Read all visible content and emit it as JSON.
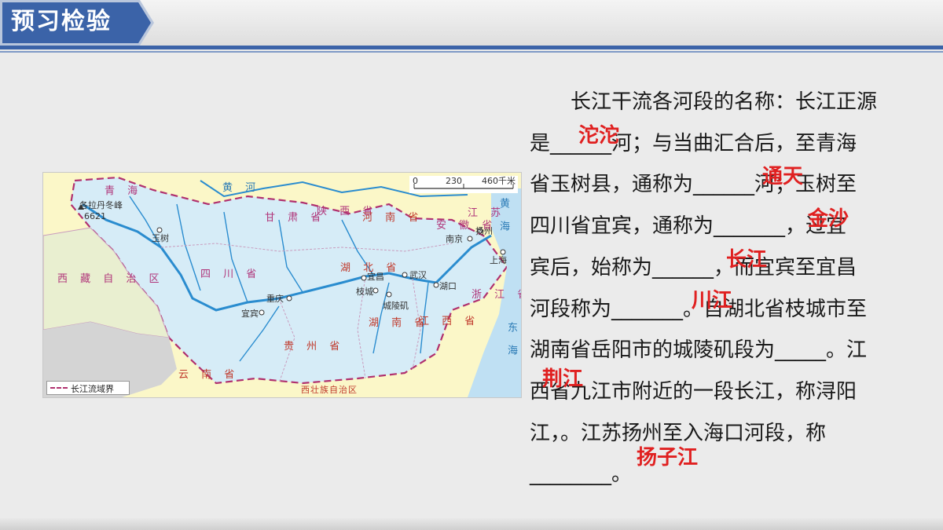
{
  "header": {
    "title": "预习检验"
  },
  "map": {
    "scale_labels": [
      "0",
      "230",
      "460千米"
    ],
    "legend_label": "长江流域界",
    "places": {
      "geladandong": "各拉丹冬峰",
      "geladandong_alt": "6621",
      "yushu": "玉树",
      "chongqing": "重庆",
      "yibin": "宜宾",
      "yichang": "宜昌",
      "zhicheng": "枝城",
      "chenglingji": "城陵矶",
      "wuhan": "武汉",
      "hukou": "湖口",
      "nanjing": "南京",
      "yangzhou": "扬州",
      "shanghai": "上海"
    },
    "regions": {
      "tibet": "西 藏 自 治 区",
      "qinghai": "青 海",
      "gansu": "甘 肃 省",
      "shaanxi": "陕 西 省",
      "sichuan": "四 川 省",
      "henan": "河 南 省",
      "hubei": "湖 北 省",
      "hunan": "湖 南 省",
      "jiangxi": "江 西 省",
      "anhui": "安 徽 省",
      "jiangsu": "江 苏",
      "zhejiang": "浙 江 省",
      "guizhou": "贵 州 省",
      "yunnan": "云 南 省",
      "guangxi": "西壮族自治区",
      "yellow_sea": "黄 海",
      "east_sea": "东 海",
      "yellow_river": "黄 河"
    }
  },
  "text": {
    "lines": [
      "　　长江干流各河段的名称：长江正源",
      "是______河；与当曲汇合后，至青海",
      "省玉树县，通称为______河；玉树至",
      "四川省宜宾，通称为_______，过宜",
      "宾后，始称为______，而宜宾至宜昌",
      "河段称为_______。自湖北省枝城市至",
      "湖南省岳阳市的城陵矶段为_____。江",
      "西省九江市附近的一段长江，称浔阳",
      "江，。江苏扬州至入海口河段，称",
      "________。"
    ]
  },
  "answers": {
    "a1": "沱沱",
    "a2": "通天",
    "a3": "金沙",
    "a4": "长江",
    "a5": "川江",
    "a6": "荆江",
    "a7": "扬子江"
  },
  "colors": {
    "header_blue": "#3b63a8",
    "answer_red": "#e02020",
    "basin_border": "#b0306e",
    "river": "#2a8ccf"
  }
}
